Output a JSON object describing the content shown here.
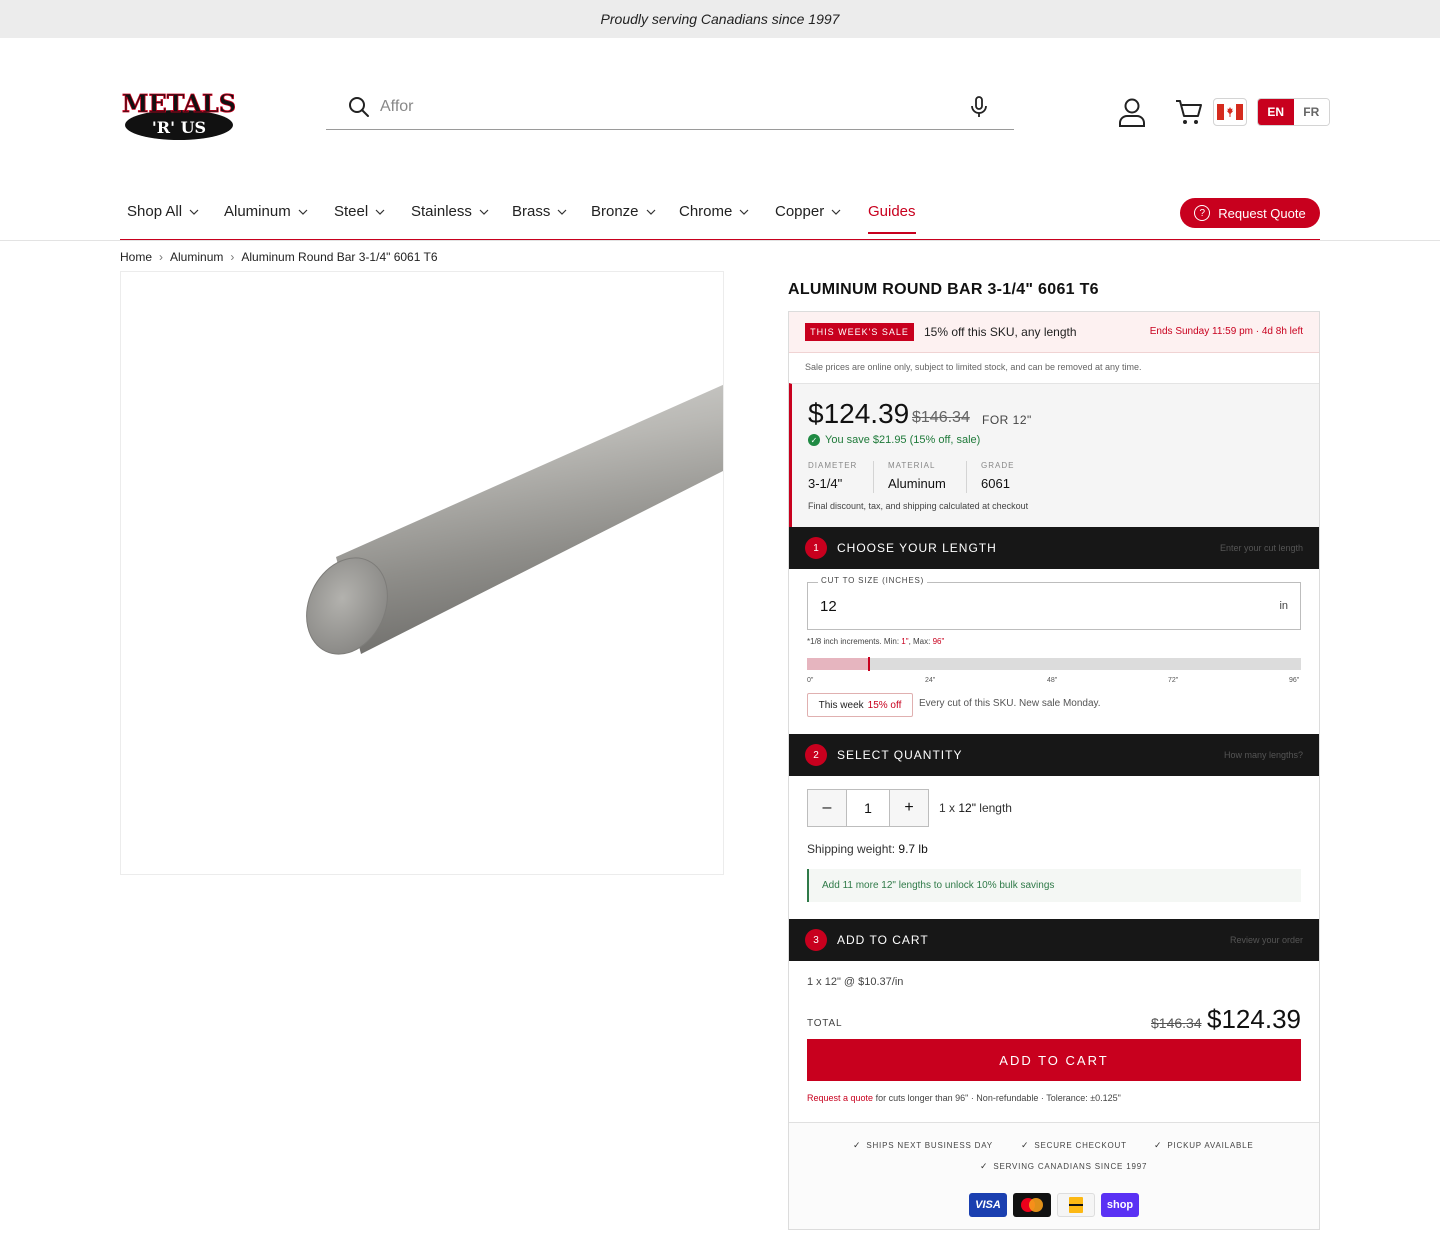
{
  "announcement": "Proudly serving Canadians since 1997",
  "brand": {
    "logo_line1": "METALS",
    "logo_line2": "'R' US"
  },
  "search": {
    "placeholder": "Affor"
  },
  "header": {
    "lang_en": "EN",
    "lang_fr": "FR"
  },
  "nav": {
    "items": [
      "Shop All",
      "Aluminum",
      "Steel",
      "Stainless",
      "Brass",
      "Bronze",
      "Chrome",
      "Copper"
    ],
    "guides": "Guides",
    "request_quote": "Request Quote"
  },
  "breadcrumb": [
    "Home",
    "Aluminum",
    "Aluminum Round Bar 3-1/4\" 6061 T6"
  ],
  "product": {
    "title": "ALUMINUM ROUND BAR 3-1/4\" 6061 T6",
    "sale": {
      "tag": "THIS WEEK'S SALE",
      "text": "15% off this SKU, any length",
      "ends": "Ends Sunday 11:59 pm · 4d 8h left",
      "note": "Sale prices are online only, subject to limited stock, and can be removed at any time."
    },
    "price": {
      "current": "$124.39",
      "original": "$146.34",
      "for_label": "FOR 12\"",
      "savings": "You save $21.95 (15% off, sale)",
      "note": "Final discount, tax, and shipping calculated at checkout"
    },
    "specs": [
      {
        "label": "DIAMETER",
        "value": "3-1/4\""
      },
      {
        "label": "MATERIAL",
        "value": "Aluminum"
      },
      {
        "label": "GRADE",
        "value": "6061"
      }
    ]
  },
  "steps": {
    "length": {
      "num": "1",
      "title": "CHOOSE YOUR LENGTH",
      "hint": "Enter your cut length",
      "field_label": "CUT TO SIZE (INCHES)",
      "value": "12",
      "unit": "in",
      "note_prefix": "*1/8 inch increments. Min: ",
      "min": "1\"",
      "note_mid": ", Max: ",
      "max": "96\"",
      "slider_fraction": 0.125,
      "ticks": [
        "0\"",
        "24\"",
        "48\"",
        "72\"",
        "96\""
      ],
      "chip_label": "This week",
      "chip_value": "15% off",
      "chip_text": "Every cut of this SKU. New sale Monday."
    },
    "quantity": {
      "num": "2",
      "title": "SELECT QUANTITY",
      "hint": "How many lengths?",
      "minus": "–",
      "value": "1",
      "plus": "+",
      "desc_prefix": "1 x ",
      "desc_length": "12\"",
      "desc_suffix": " length",
      "weight_label": "Shipping weight: ",
      "weight_value": "9.7 lb",
      "bulk": "Add 11 more 12\" lengths to unlock 10% bulk savings"
    },
    "cart": {
      "num": "3",
      "title": "ADD TO CART",
      "hint": "Review your order",
      "line": "1 x 12\" @ $10.37/in",
      "total_label": "TOTAL",
      "total_old": "$146.34",
      "total_new": "$124.39",
      "button": "ADD TO CART",
      "fine_link": "Request a quote",
      "fine_text": " for cuts longer than 96\" · Non-refundable · Tolerance: ±0.125\""
    }
  },
  "trust": [
    "SHIPS NEXT BUSINESS DAY",
    "SECURE CHECKOUT",
    "PICKUP AVAILABLE",
    "SERVING CANADIANS SINCE 1997"
  ],
  "payments": [
    "VISA",
    "mastercard",
    "interac",
    "shop"
  ],
  "colors": {
    "accent": "#c8001e",
    "dark_bar": "#171717",
    "success": "#1f7a3a"
  }
}
